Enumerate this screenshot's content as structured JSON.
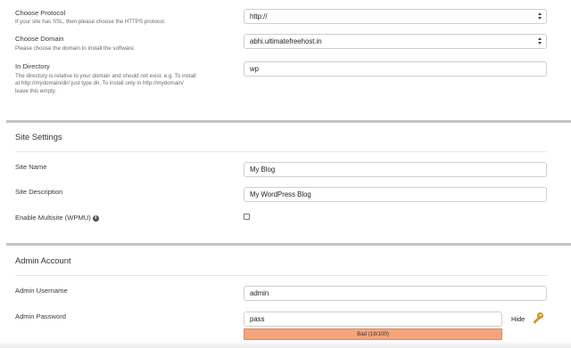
{
  "protocol": {
    "label": "Choose Protocol",
    "hint": "If your site has SSL, then please choose the HTTPS protocol.",
    "value": "http://"
  },
  "domain": {
    "label": "Choose Domain",
    "hint": "Please choose the domain to install the software.",
    "value": "abhi.ultimatefreehost.in"
  },
  "directory": {
    "label": "In Directory",
    "hint_lines": [
      "The directory is relative to your domain and should not exist. e.g. To install",
      "at http://mydomain/dir/ just type dir. To install only in http://mydomain/",
      "leave this empty."
    ],
    "value": "wp"
  },
  "site_settings": {
    "title": "Site Settings",
    "site_name_label": "Site Name",
    "site_name_value": "My Blog",
    "site_description_label": "Site Description",
    "site_description_value": "My WordPress Blog",
    "multisite_label": "Enable Multisite (WPMU)",
    "multisite_info_glyph": "i",
    "multisite_checked": false
  },
  "admin_account": {
    "title": "Admin Account",
    "username_label": "Admin Username",
    "username_value": "admin",
    "password_label": "Admin Password",
    "password_value": "pass",
    "hide_label": "Hide",
    "strength_text": "Bad (18/100)",
    "strength_score": 18,
    "strength_color": "#f4a57c",
    "key_icon": "key-icon"
  }
}
